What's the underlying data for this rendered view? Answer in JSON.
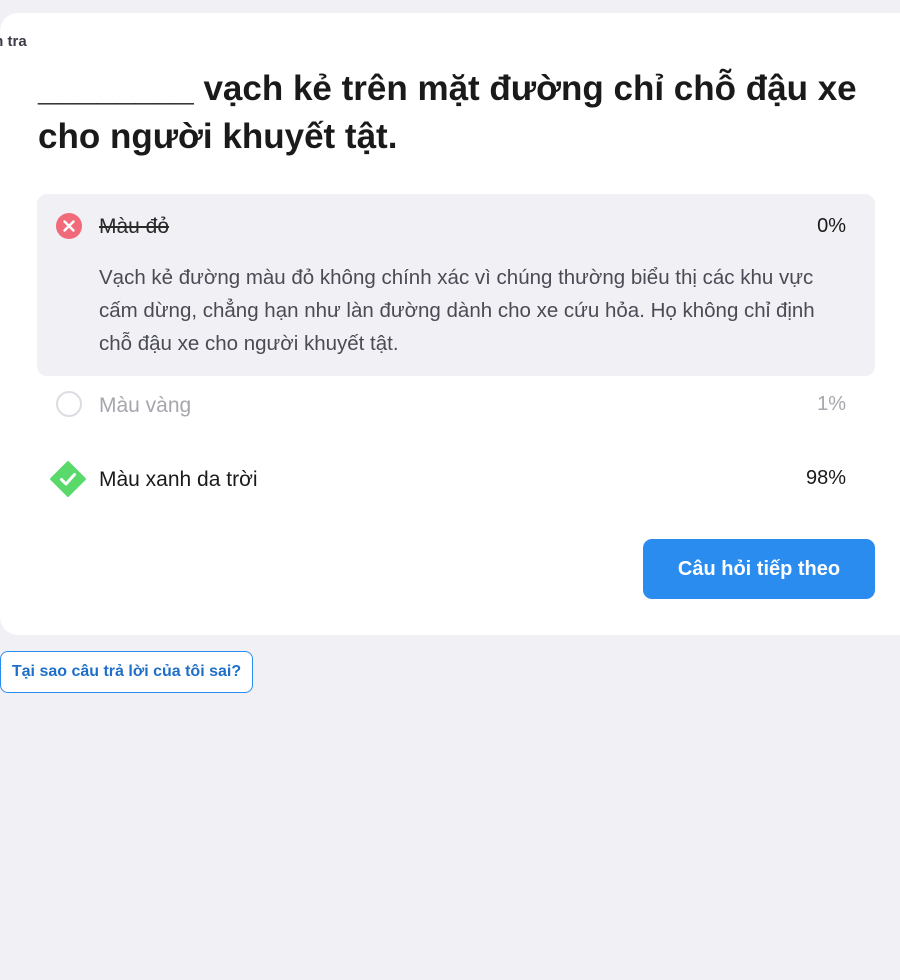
{
  "header": {
    "cut_label": "m tra"
  },
  "question": {
    "text": "________ vạch kẻ trên mặt đường chỉ chỗ đậu xe cho người khuyết tật."
  },
  "options": [
    {
      "label": "Màu đỏ",
      "percent": "0%",
      "state": "wrong-selected",
      "explanation": "Vạch kẻ đường màu đỏ không chính xác vì chúng thường biểu thị các khu vực cấm dừng, chẳng hạn như làn đường dành cho xe cứu hỏa. Họ không chỉ định chỗ đậu xe cho người khuyết tật."
    },
    {
      "label": "Màu vàng",
      "percent": "1%",
      "state": "unselected"
    },
    {
      "label": "Màu xanh da trời",
      "percent": "98%",
      "state": "correct"
    }
  ],
  "actions": {
    "next_label": "Câu hỏi tiếp theo",
    "why_label": "Tại sao câu trả lời của tôi sai?"
  },
  "colors": {
    "wrong": "#f06a7a",
    "correct": "#59d96a",
    "primary": "#2b8cf0",
    "panel": "#f0f0f5"
  },
  "icons": {
    "wrong": "x-circle-icon",
    "unselected": "empty-circle-icon",
    "correct": "check-diamond-icon"
  }
}
